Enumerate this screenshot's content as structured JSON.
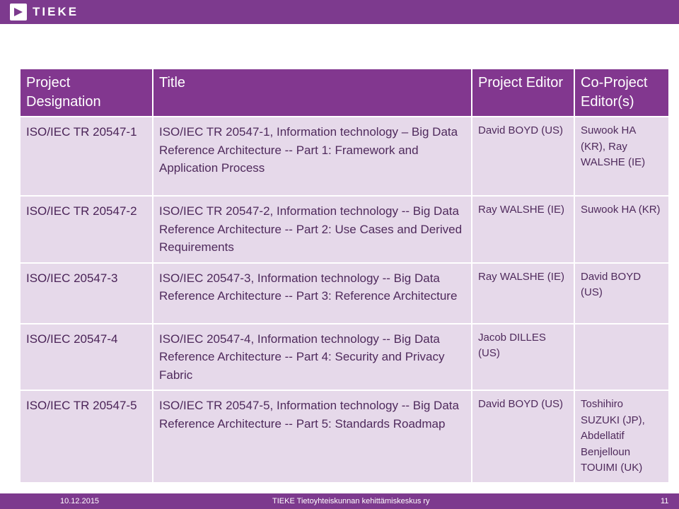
{
  "header": {
    "brand": "TIEKE",
    "brand_color": "#7d3a8e"
  },
  "table": {
    "header_color": "#82378f",
    "row_color": "#e6d9ea",
    "headers": [
      "Project Designation",
      "Title",
      "Project Editor",
      "Co-Project Editor(s)"
    ],
    "rows": [
      {
        "designation": "ISO/IEC TR 20547-1",
        "title": "ISO/IEC TR 20547-1, Information technology – Big Data Reference Architecture -- Part 1: Framework and Application Process",
        "editor": "David BOYD (US)",
        "co_editors": "Suwook HA (KR), Ray WALSHE (IE)"
      },
      {
        "designation": "ISO/IEC TR 20547-2",
        "title": "ISO/IEC TR 20547-2, Information technology -- Big Data Reference Architecture -- Part 2: Use Cases and Derived Requirements",
        "editor": "Ray WALSHE (IE)",
        "co_editors": "Suwook HA (KR)"
      },
      {
        "designation": "ISO/IEC 20547-3",
        "title": "ISO/IEC 20547-3, Information technology -- Big Data Reference Architecture -- Part 3: Reference Architecture",
        "editor": "Ray WALSHE (IE)",
        "co_editors": "David BOYD (US)"
      },
      {
        "designation": "ISO/IEC 20547-4",
        "title": "ISO/IEC 20547-4, Information technology -- Big Data Reference Architecture -- Part 4: Security and Privacy Fabric",
        "editor": "Jacob DILLES (US)",
        "co_editors": ""
      },
      {
        "designation": "ISO/IEC TR 20547-5",
        "title": "ISO/IEC TR 20547-5, Information technology -- Big Data Reference Architecture -- Part 5: Standards Roadmap",
        "editor": "David BOYD (US)",
        "co_editors": "Toshihiro SUZUKI (JP), Abdellatif Benjelloun TOUIMI (UK)"
      }
    ]
  },
  "footer": {
    "date": "10.12.2015",
    "organization": "TIEKE Tietoyhteiskunnan kehittämiskeskus ry",
    "page_number": "11"
  }
}
